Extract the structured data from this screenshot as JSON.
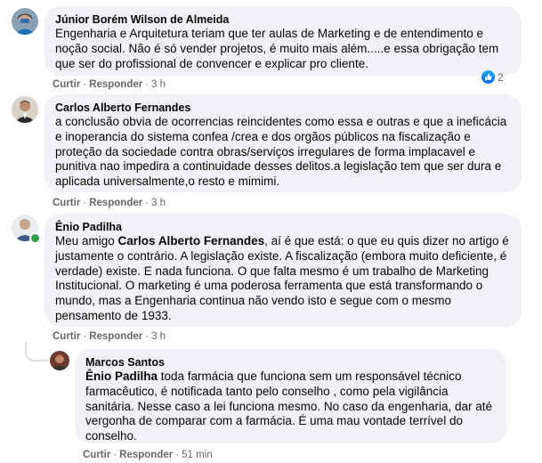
{
  "comments": [
    {
      "author": "Júnior Borém Wilson de Almeida",
      "text": "Engenharia e Arquitetura teriam que ter aulas de Marketing e de entendimento e noção social. Não é só vender projetos, é muito mais além.....e essa obrigação tem que ser do profissional de convencer e explicar pro cliente.",
      "like_label": "Curtir",
      "reply_label": "Responder",
      "time": "3 h",
      "reaction_count": "2"
    },
    {
      "author": "Carlos Alberto Fernandes",
      "text": "a conclusão obvia de ocorrencias reincidentes como essa e outras e que a ineficácia e inoperancia do sistema confea /crea e dos orgãos públicos na fiscalização e proteção da sociedade contra obras/serviços irregulares de forma implacavel e punitiva nao impedira a continuidade desses delitos.a legislação tem que ser dura e aplicada universalmente,o resto e mimimi.",
      "like_label": "Curtir",
      "reply_label": "Responder",
      "time": "3 h"
    },
    {
      "author": "Ênio Padilha",
      "text_before": "Meu amigo ",
      "mention": "Carlos Alberto Fernandes",
      "text_after": ", aí é que está: o que eu quis dizer no artigo é justamente o contrário. A legislação existe. A fiscalização (embora muito deficiente, é verdade) existe. E nada funciona. O que falta mesmo é um trabalho de Marketing Institucional. O marketing é uma poderosa ferramenta que está transformando o mundo, mas a Engenharia continua não vendo isto e segue com o mesmo pensamento de 1933.",
      "like_label": "Curtir",
      "reply_label": "Responder",
      "time": "3 h"
    },
    {
      "author": "Marcos Santos",
      "mention": "Ênio Padilha",
      "text_after": " toda farmácia que funciona sem um responsável técnico farmacêutico, é notificada tanto pelo conselho , como pela vigilância sanitária. Nesse caso a lei funciona mesmo. No caso da engenharia, dar até vergonha de comparar com a farmácia. É uma mau vontade terrível do conselho.",
      "like_label": "Curtir",
      "reply_label": "Responder",
      "time": "51 min"
    }
  ],
  "separator": "·",
  "colors": {
    "bubble": "#f0f2f5",
    "meta": "#65676b",
    "like_blue": "#1877f2",
    "online": "#31a24c"
  },
  "icons": {
    "like": "thumbs-up-icon"
  }
}
